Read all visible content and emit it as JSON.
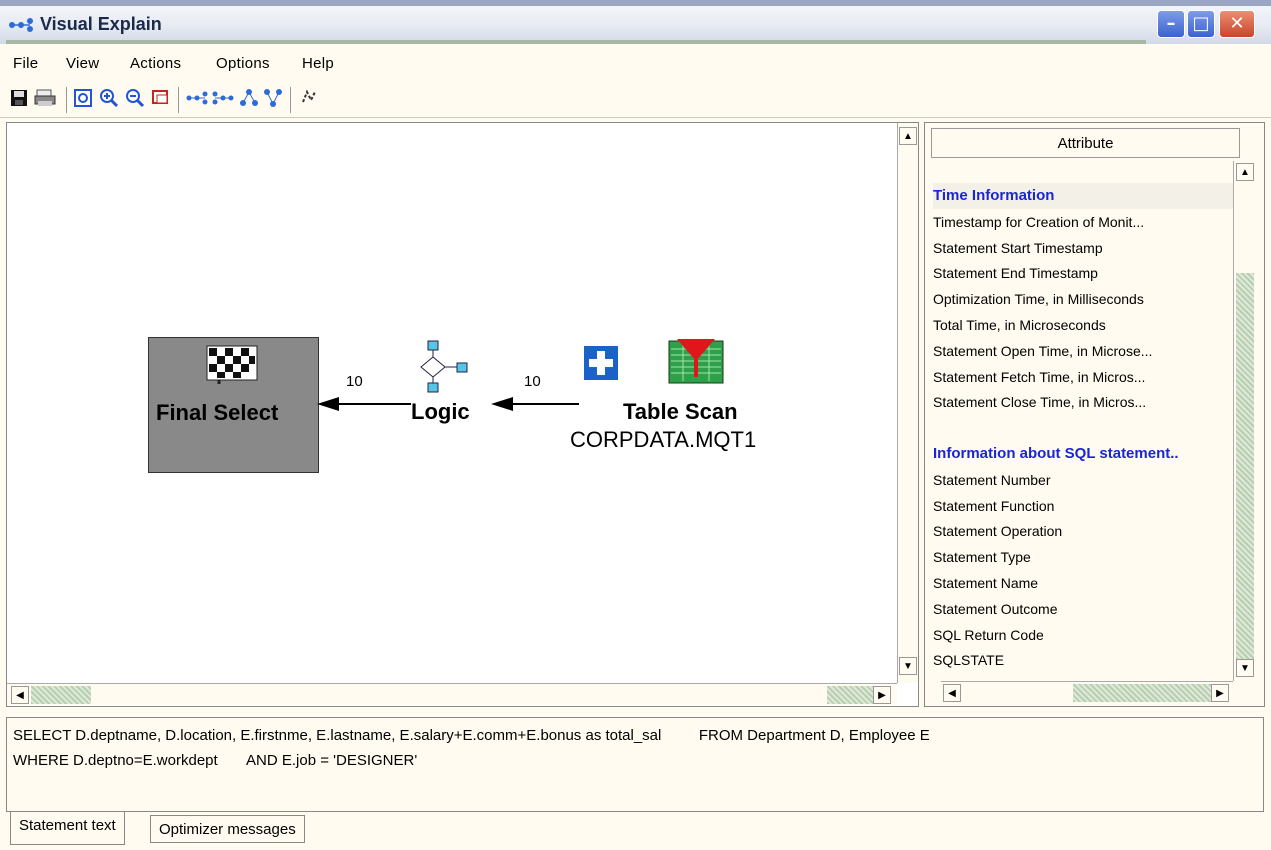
{
  "window": {
    "title": "Visual Explain"
  },
  "menu": [
    {
      "label": "File"
    },
    {
      "label": "View"
    },
    {
      "label": "Actions"
    },
    {
      "label": "Options"
    },
    {
      "label": "Help"
    }
  ],
  "toolbar": {
    "buttons": [
      "save-icon",
      "print-icon",
      "fit-icon",
      "zoom-in-icon",
      "zoom-out-icon",
      "overview-icon",
      "graph-horizontal-icon",
      "graph-vertical-icon",
      "tree-icon",
      "tree-alt-icon",
      "refresh-icon"
    ]
  },
  "graph": {
    "final_select": {
      "label": "Final Select"
    },
    "logic": {
      "label": "Logic"
    },
    "table_scan": {
      "label": "Table Scan",
      "table": "CORPDATA.MQT1"
    },
    "edges": [
      {
        "label": "10"
      },
      {
        "label": "10"
      }
    ]
  },
  "attributes": {
    "header": "Attribute",
    "rows": [
      {
        "label": "Time Information",
        "type": "header"
      },
      {
        "label": "Timestamp for Creation of Monit...",
        "type": "item"
      },
      {
        "label": "Statement Start Timestamp",
        "type": "item"
      },
      {
        "label": "Statement End Timestamp",
        "type": "item"
      },
      {
        "label": "Optimization Time, in Milliseconds",
        "type": "item"
      },
      {
        "label": "Total Time, in Microseconds",
        "type": "item"
      },
      {
        "label": "Statement Open Time, in Microse...",
        "type": "item"
      },
      {
        "label": "Statement Fetch Time, in Micros...",
        "type": "item"
      },
      {
        "label": "Statement Close Time, in Micros...",
        "type": "item"
      },
      {
        "label": "",
        "type": "blank"
      },
      {
        "label": "Information about SQL statement..",
        "type": "header"
      },
      {
        "label": "Statement Number",
        "type": "item"
      },
      {
        "label": "Statement Function",
        "type": "item"
      },
      {
        "label": "Statement Operation",
        "type": "item"
      },
      {
        "label": "Statement Type",
        "type": "item"
      },
      {
        "label": "Statement Name",
        "type": "item"
      },
      {
        "label": "Statement Outcome",
        "type": "item"
      },
      {
        "label": "SQL Return Code",
        "type": "item"
      },
      {
        "label": "SQLSTATE",
        "type": "item"
      }
    ]
  },
  "sql": {
    "line1": "SELECT D.deptname, D.location, E.firstnme, E.lastname, E.salary+E.comm+E.bonus as total_sal         FROM Department D, Employee E",
    "line2": "WHERE D.deptno=E.workdept       AND E.job = 'DESIGNER'"
  },
  "tabs": [
    {
      "label": "Statement text",
      "active": true
    },
    {
      "label": "Optimizer messages",
      "active": false
    }
  ]
}
